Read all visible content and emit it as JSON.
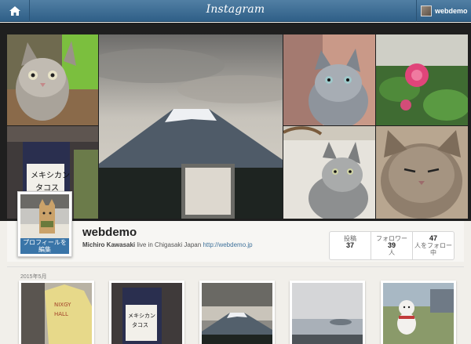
{
  "navbar": {
    "brand": "Instagram",
    "home_icon": "home-icon",
    "account_name": "webdemo"
  },
  "profile": {
    "username": "webdemo",
    "full_name": "Michiro Kawasaki",
    "bio": "live in Chigasaki Japan",
    "website": "http://webdemo.jp",
    "edit_button_line1": "プロフィールを",
    "edit_button_line2": "編集"
  },
  "stats": [
    {
      "label": "投稿",
      "value": "37"
    },
    {
      "label": "フォロワー",
      "value": "39",
      "unit": "人"
    },
    {
      "label": "人をフォロー中",
      "value": "47"
    }
  ],
  "feed": {
    "section_date": "2015年5月"
  },
  "cover_tiles": [
    "cat-closeup",
    "cafe-sign",
    "mount-fuji",
    "cat-tabby",
    "pink-flower",
    "cat-sitting",
    "cat-grumpy"
  ],
  "thumbnails": [
    "shirt-photo",
    "cafe-sign",
    "mount-fuji",
    "sea-view",
    "garden-doll"
  ],
  "colors": {
    "navbar": "#3f6d94",
    "accent": "#3a75a8",
    "link": "#3f729b",
    "background": "#f1efea"
  }
}
